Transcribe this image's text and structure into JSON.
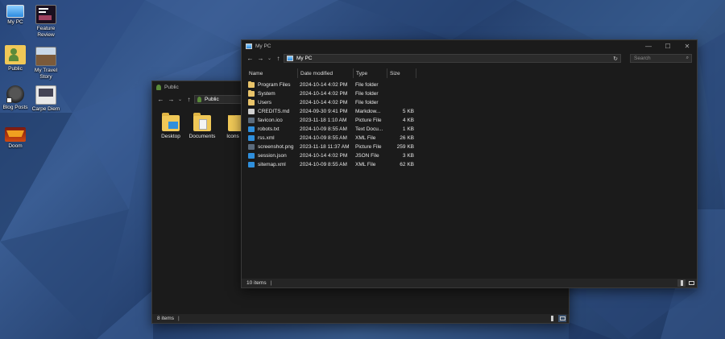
{
  "desktop": {
    "icons": [
      {
        "label": "My PC",
        "icon": "computer-icon"
      },
      {
        "label": "Feature Review",
        "icon": "video-thumbnail-icon"
      },
      {
        "label": "Public",
        "icon": "user-folder-icon"
      },
      {
        "label": "My Travel Story",
        "icon": "video-thumbnail-icon"
      },
      {
        "label": "Blog Posts",
        "icon": "shortcut-icon"
      },
      {
        "label": "Carpe Diem",
        "icon": "image-thumbnail-icon"
      },
      {
        "label": "Doom",
        "icon": "game-icon"
      }
    ]
  },
  "public_window": {
    "title": "Public",
    "address": "Public",
    "items": [
      {
        "label": "Desktop",
        "icon": "desktop-folder-icon"
      },
      {
        "label": "Documents",
        "icon": "documents-folder-icon"
      },
      {
        "label": "Icons",
        "icon": "folder-icon"
      }
    ],
    "status": "8 items",
    "status_sep": "|"
  },
  "mypc_window": {
    "title": "My PC",
    "address": "My PC",
    "search_placeholder": "Search",
    "controls": {
      "minimize": "—",
      "maximize": "☐",
      "close": "✕"
    },
    "columns": [
      "Name",
      "Date modified",
      "Type",
      "Size"
    ],
    "rows": [
      {
        "name": "Program Files",
        "date": "2024-10-14 4:02 PM",
        "type": "File folder",
        "size": "",
        "icon": "folder-icon"
      },
      {
        "name": "System",
        "date": "2024-10-14 4:02 PM",
        "type": "File folder",
        "size": "",
        "icon": "folder-icon"
      },
      {
        "name": "Users",
        "date": "2024-10-14 4:02 PM",
        "type": "File folder",
        "size": "",
        "icon": "folder-icon"
      },
      {
        "name": "CREDITS.md",
        "date": "2024-09-30 9:41 PM",
        "type": "Markdow...",
        "size": "5 KB",
        "icon": "markdown-file-icon"
      },
      {
        "name": "favicon.ico",
        "date": "2023-11-18 1:10 AM",
        "type": "Picture File",
        "size": "4 KB",
        "icon": "image-file-icon"
      },
      {
        "name": "robots.txt",
        "date": "2024-10-09 8:55 AM",
        "type": "Text Docu...",
        "size": "1 KB",
        "icon": "vscode-file-icon"
      },
      {
        "name": "rss.xml",
        "date": "2024-10-09 8:55 AM",
        "type": "XML File",
        "size": "26 KB",
        "icon": "vscode-file-icon"
      },
      {
        "name": "screenshot.png",
        "date": "2023-11-18 11:37 AM",
        "type": "Picture File",
        "size": "259 KB",
        "icon": "image-file-icon"
      },
      {
        "name": "session.json",
        "date": "2024-10-14 4:02 PM",
        "type": "JSON File",
        "size": "3 KB",
        "icon": "vscode-file-icon"
      },
      {
        "name": "sitemap.xml",
        "date": "2024-10-09 8:55 AM",
        "type": "XML File",
        "size": "62 KB",
        "icon": "vscode-file-icon"
      }
    ],
    "status": "10 items",
    "status_sep": "|"
  },
  "colors": {
    "window_bg": "#1b1b1b",
    "accent": "#2f8fdc",
    "folder": "#e9c46a"
  }
}
